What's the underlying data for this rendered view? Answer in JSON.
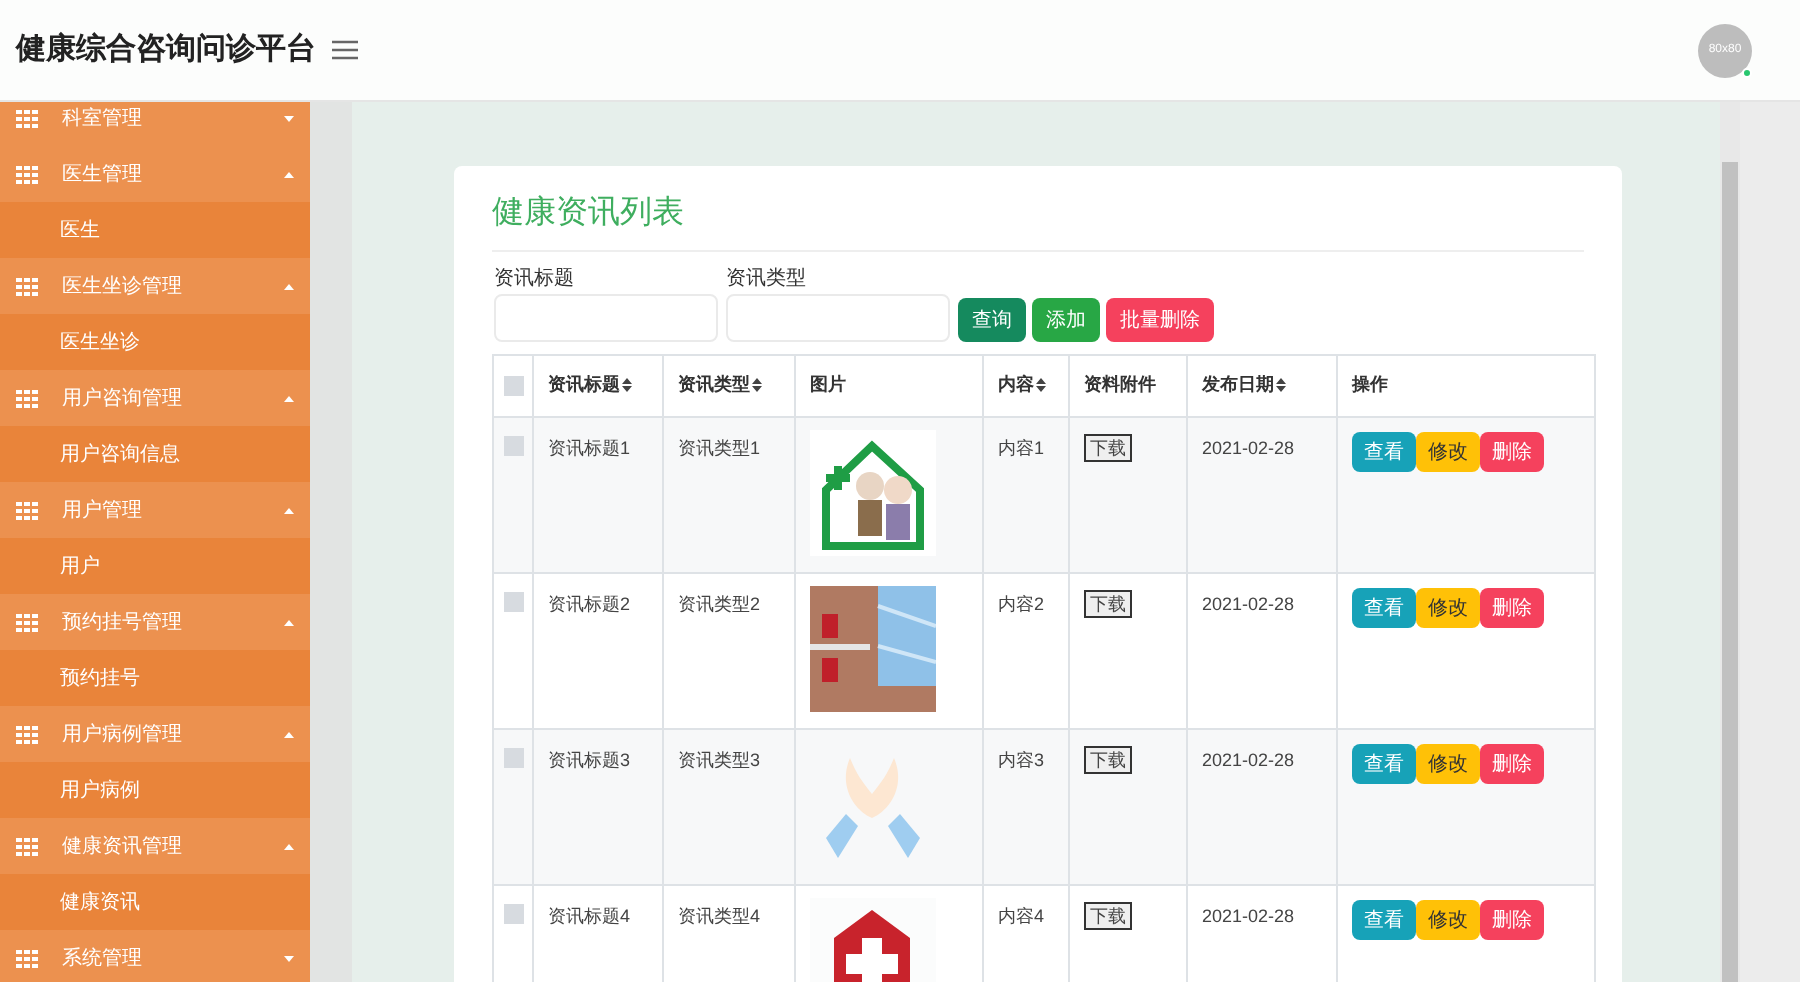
{
  "app_title": "健康综合咨询问诊平台",
  "avatar": {
    "text": "80x80",
    "online": true
  },
  "sidebar": {
    "groups": [
      {
        "label": "科室管理",
        "expanded": false
      },
      {
        "label": "医生管理",
        "expanded": true,
        "children": [
          {
            "label": "医生"
          }
        ]
      },
      {
        "label": "医生坐诊管理",
        "expanded": true,
        "children": [
          {
            "label": "医生坐诊"
          }
        ]
      },
      {
        "label": "用户咨询管理",
        "expanded": true,
        "children": [
          {
            "label": "用户咨询信息"
          }
        ]
      },
      {
        "label": "用户管理",
        "expanded": true,
        "children": [
          {
            "label": "用户"
          }
        ]
      },
      {
        "label": "预约挂号管理",
        "expanded": true,
        "children": [
          {
            "label": "预约挂号"
          }
        ]
      },
      {
        "label": "用户病例管理",
        "expanded": true,
        "children": [
          {
            "label": "用户病例"
          }
        ]
      },
      {
        "label": "健康资讯管理",
        "expanded": true,
        "children": [
          {
            "label": "健康资讯"
          }
        ]
      },
      {
        "label": "系统管理",
        "expanded": false
      }
    ]
  },
  "page_title": "健康资讯列表",
  "filters": [
    {
      "label": "资讯标题"
    },
    {
      "label": "资讯类型"
    }
  ],
  "buttons": [
    {
      "label": "查询",
      "kind": "search"
    },
    {
      "label": "添加",
      "kind": "add"
    },
    {
      "label": "批量删除",
      "kind": "delete"
    }
  ],
  "table": {
    "select_all_checked": false,
    "columns": [
      {
        "label": "资讯标题",
        "sortable": true
      },
      {
        "label": "资讯类型",
        "sortable": true
      },
      {
        "label": "图片",
        "sortable": false
      },
      {
        "label": "内容",
        "sortable": true
      },
      {
        "label": "资料附件",
        "sortable": false
      },
      {
        "label": "发布日期",
        "sortable": true
      },
      {
        "label": "操作",
        "sortable": false
      }
    ],
    "rows": [
      {
        "title": "资讯标题1",
        "type": "资讯类型1",
        "content": "内容1",
        "attachment": "下载",
        "date": "2021-02-28",
        "actions": [
          "查看",
          "修改",
          "删除"
        ],
        "checked": false
      },
      {
        "title": "资讯标题2",
        "type": "资讯类型2",
        "content": "内容2",
        "attachment": "下载",
        "date": "2021-02-28",
        "actions": [
          "查看",
          "修改",
          "删除"
        ],
        "checked": false
      },
      {
        "title": "资讯标题3",
        "type": "资讯类型3",
        "content": "内容3",
        "attachment": "下载",
        "date": "2021-02-28",
        "actions": [
          "查看",
          "修改",
          "删除"
        ],
        "checked": false
      },
      {
        "title": "资讯标题4",
        "type": "资讯类型4",
        "content": "内容4",
        "attachment": "下载",
        "date": "2021-02-28",
        "actions": [
          "查看",
          "修改",
          "删除"
        ],
        "checked": false
      }
    ]
  }
}
